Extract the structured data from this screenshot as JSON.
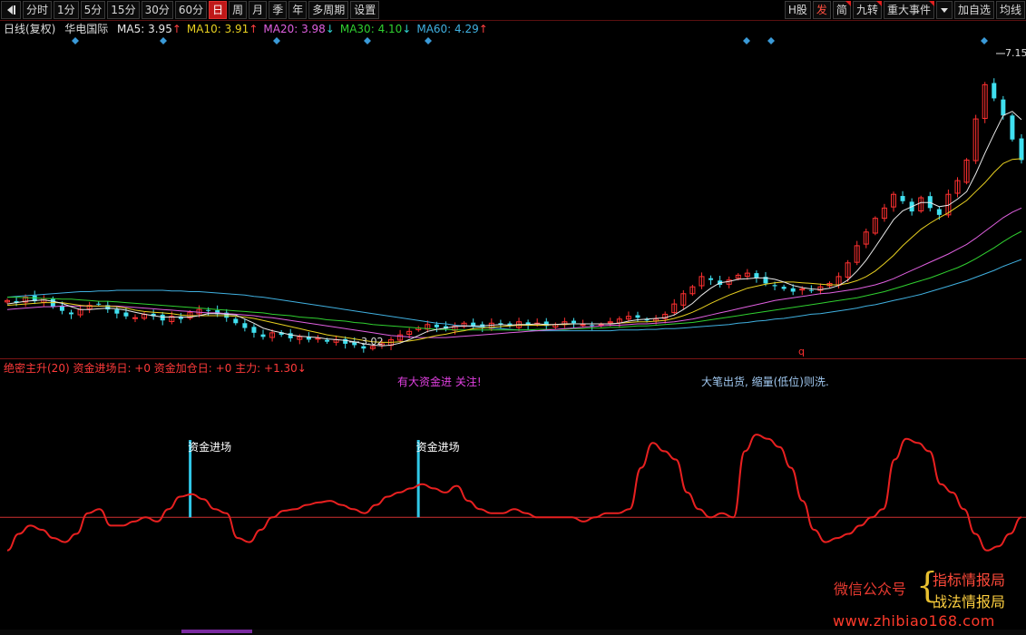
{
  "toolbar": {
    "periods": [
      "分时",
      "1分",
      "5分",
      "15分",
      "30分",
      "60分",
      "日",
      "周",
      "月",
      "季",
      "年",
      "多周期",
      "设置"
    ],
    "active_period": "日",
    "right_buttons": [
      "H股",
      "发",
      "简",
      "九转",
      "重大事件",
      "加自选",
      "均线"
    ]
  },
  "legend": {
    "period": "日线(复权)",
    "stock_name": "华电国际",
    "ma": [
      {
        "label": "MA5:",
        "value": "3.95",
        "arrow": "↑",
        "color": "#e8e8e8"
      },
      {
        "label": "MA10:",
        "value": "3.91",
        "arrow": "↑",
        "color": "#e8d020"
      },
      {
        "label": "MA20:",
        "value": "3.98",
        "arrow": "↓",
        "color": "#e060e0"
      },
      {
        "label": "MA30:",
        "value": "4.10",
        "arrow": "↓",
        "color": "#30d030"
      },
      {
        "label": "MA60:",
        "value": "4.29",
        "arrow": "↑",
        "color": "#40b0e0"
      }
    ]
  },
  "price_panel": {
    "high_label": "7.15",
    "low_label": "3.02",
    "marker_q": "q"
  },
  "indicator": {
    "legend": "绝密主升(20) 资金进场日: +0 资金加仓日: +0 主力: +1.30↓",
    "note_1": "有大资金进  关注!",
    "note_2": "大笔出货, 缩量(低位)则洗.",
    "signal_label": "资金进场"
  },
  "watermark": {
    "wechat": "微信公众号",
    "brace": "{",
    "line1": "指标情报局",
    "line2": "战法情报局",
    "url": "www.zhibiao168.com"
  },
  "chart_data": {
    "type": "candlestick",
    "ylim": [
      3.0,
      7.5
    ],
    "close": [
      3.75,
      3.72,
      3.8,
      3.74,
      3.78,
      3.66,
      3.6,
      3.55,
      3.62,
      3.68,
      3.7,
      3.62,
      3.56,
      3.52,
      3.5,
      3.55,
      3.52,
      3.46,
      3.52,
      3.48,
      3.58,
      3.62,
      3.6,
      3.55,
      3.5,
      3.42,
      3.35,
      3.28,
      3.22,
      3.28,
      3.25,
      3.2,
      3.22,
      3.18,
      3.2,
      3.15,
      3.18,
      3.12,
      3.1,
      3.05,
      3.08,
      3.12,
      3.18,
      3.25,
      3.3,
      3.35,
      3.4,
      3.36,
      3.34,
      3.38,
      3.42,
      3.38,
      3.36,
      3.42,
      3.4,
      3.38,
      3.44,
      3.4,
      3.42,
      3.38,
      3.4,
      3.44,
      3.42,
      3.4,
      3.38,
      3.4,
      3.44,
      3.48,
      3.52,
      3.5,
      3.46,
      3.48,
      3.55,
      3.7,
      3.85,
      3.95,
      4.1,
      4.05,
      3.98,
      4.05,
      4.12,
      4.15,
      4.08,
      4.0,
      3.96,
      3.92,
      3.88,
      3.92,
      3.9,
      3.95,
      4.0,
      4.1,
      4.3,
      4.55,
      4.75,
      4.95,
      5.1,
      5.3,
      5.2,
      5.05,
      5.25,
      5.1,
      5.0,
      5.3,
      5.5,
      5.8,
      6.4,
      6.9,
      6.7,
      6.45,
      6.1,
      5.8
    ],
    "ma5": [
      3.7,
      3.72,
      3.74,
      3.75,
      3.76,
      3.74,
      3.71,
      3.66,
      3.62,
      3.62,
      3.63,
      3.64,
      3.63,
      3.61,
      3.58,
      3.55,
      3.53,
      3.51,
      3.51,
      3.51,
      3.51,
      3.53,
      3.56,
      3.56,
      3.55,
      3.54,
      3.48,
      3.42,
      3.35,
      3.31,
      3.28,
      3.25,
      3.23,
      3.22,
      3.21,
      3.19,
      3.18,
      3.17,
      3.15,
      3.12,
      3.1,
      3.09,
      3.1,
      3.13,
      3.18,
      3.24,
      3.3,
      3.33,
      3.35,
      3.37,
      3.38,
      3.38,
      3.38,
      3.39,
      3.4,
      3.39,
      3.4,
      3.4,
      3.41,
      3.4,
      3.4,
      3.41,
      3.41,
      3.41,
      3.41,
      3.41,
      3.41,
      3.42,
      3.45,
      3.47,
      3.48,
      3.49,
      3.5,
      3.54,
      3.62,
      3.71,
      3.83,
      3.93,
      4.01,
      4.03,
      4.06,
      4.07,
      4.08,
      4.08,
      4.06,
      4.02,
      3.97,
      3.94,
      3.92,
      3.91,
      3.93,
      3.97,
      4.05,
      4.18,
      4.34,
      4.53,
      4.73,
      4.93,
      5.06,
      5.12,
      5.18,
      5.18,
      5.12,
      5.14,
      5.23,
      5.34,
      5.6,
      5.9,
      6.18,
      6.45,
      6.51,
      6.39
    ],
    "ma10": [
      3.68,
      3.69,
      3.7,
      3.71,
      3.72,
      3.72,
      3.72,
      3.7,
      3.68,
      3.67,
      3.67,
      3.67,
      3.66,
      3.64,
      3.61,
      3.59,
      3.58,
      3.57,
      3.56,
      3.54,
      3.53,
      3.53,
      3.53,
      3.53,
      3.53,
      3.52,
      3.51,
      3.49,
      3.46,
      3.43,
      3.4,
      3.37,
      3.34,
      3.31,
      3.28,
      3.25,
      3.23,
      3.21,
      3.19,
      3.17,
      3.15,
      3.14,
      3.14,
      3.15,
      3.16,
      3.18,
      3.21,
      3.24,
      3.26,
      3.29,
      3.31,
      3.34,
      3.35,
      3.36,
      3.37,
      3.38,
      3.39,
      3.39,
      3.39,
      3.39,
      3.4,
      3.4,
      3.41,
      3.41,
      3.41,
      3.41,
      3.41,
      3.42,
      3.43,
      3.44,
      3.44,
      3.45,
      3.46,
      3.49,
      3.53,
      3.58,
      3.64,
      3.71,
      3.77,
      3.83,
      3.88,
      3.93,
      3.96,
      3.99,
      4.01,
      4.02,
      4.02,
      4.01,
      4.0,
      3.99,
      3.98,
      3.98,
      4.0,
      4.04,
      4.1,
      4.18,
      4.29,
      4.41,
      4.55,
      4.67,
      4.79,
      4.88,
      4.96,
      5.03,
      5.12,
      5.21,
      5.34,
      5.47,
      5.62,
      5.75,
      5.81,
      5.82
    ],
    "ma20": [
      3.62,
      3.63,
      3.64,
      3.65,
      3.66,
      3.66,
      3.67,
      3.67,
      3.67,
      3.67,
      3.67,
      3.67,
      3.67,
      3.66,
      3.65,
      3.64,
      3.63,
      3.62,
      3.61,
      3.6,
      3.59,
      3.58,
      3.57,
      3.57,
      3.56,
      3.55,
      3.54,
      3.53,
      3.51,
      3.5,
      3.48,
      3.46,
      3.44,
      3.42,
      3.4,
      3.38,
      3.36,
      3.34,
      3.32,
      3.3,
      3.28,
      3.26,
      3.24,
      3.23,
      3.22,
      3.21,
      3.21,
      3.21,
      3.21,
      3.22,
      3.23,
      3.24,
      3.25,
      3.26,
      3.27,
      3.28,
      3.29,
      3.3,
      3.31,
      3.32,
      3.33,
      3.34,
      3.35,
      3.36,
      3.37,
      3.38,
      3.39,
      3.39,
      3.4,
      3.41,
      3.41,
      3.42,
      3.43,
      3.44,
      3.46,
      3.48,
      3.51,
      3.54,
      3.57,
      3.6,
      3.63,
      3.66,
      3.69,
      3.72,
      3.75,
      3.77,
      3.79,
      3.81,
      3.83,
      3.85,
      3.86,
      3.88,
      3.9,
      3.92,
      3.95,
      3.98,
      4.02,
      4.07,
      4.13,
      4.19,
      4.25,
      4.31,
      4.37,
      4.43,
      4.5,
      4.57,
      4.66,
      4.76,
      4.86,
      4.96,
      5.04,
      5.1
    ],
    "ma30": [
      3.8,
      3.8,
      3.79,
      3.79,
      3.78,
      3.78,
      3.77,
      3.77,
      3.76,
      3.75,
      3.74,
      3.74,
      3.73,
      3.72,
      3.71,
      3.7,
      3.69,
      3.68,
      3.67,
      3.66,
      3.65,
      3.64,
      3.63,
      3.62,
      3.61,
      3.6,
      3.59,
      3.58,
      3.57,
      3.55,
      3.54,
      3.53,
      3.51,
      3.5,
      3.49,
      3.47,
      3.46,
      3.45,
      3.43,
      3.42,
      3.4,
      3.39,
      3.38,
      3.37,
      3.36,
      3.35,
      3.34,
      3.33,
      3.33,
      3.32,
      3.32,
      3.32,
      3.32,
      3.32,
      3.32,
      3.32,
      3.32,
      3.32,
      3.33,
      3.33,
      3.33,
      3.33,
      3.34,
      3.34,
      3.35,
      3.35,
      3.36,
      3.36,
      3.37,
      3.38,
      3.38,
      3.39,
      3.4,
      3.41,
      3.42,
      3.43,
      3.45,
      3.47,
      3.49,
      3.51,
      3.53,
      3.55,
      3.57,
      3.59,
      3.61,
      3.63,
      3.65,
      3.67,
      3.69,
      3.71,
      3.73,
      3.75,
      3.77,
      3.79,
      3.82,
      3.85,
      3.88,
      3.92,
      3.96,
      4.0,
      4.04,
      4.08,
      4.13,
      4.18,
      4.23,
      4.29,
      4.36,
      4.44,
      4.52,
      4.61,
      4.69,
      4.76
    ],
    "ma60": [
      3.8,
      3.81,
      3.82,
      3.83,
      3.84,
      3.85,
      3.86,
      3.87,
      3.88,
      3.88,
      3.89,
      3.89,
      3.9,
      3.9,
      3.9,
      3.9,
      3.9,
      3.9,
      3.89,
      3.89,
      3.88,
      3.88,
      3.87,
      3.86,
      3.85,
      3.84,
      3.83,
      3.81,
      3.8,
      3.78,
      3.76,
      3.74,
      3.72,
      3.7,
      3.68,
      3.66,
      3.64,
      3.62,
      3.6,
      3.58,
      3.56,
      3.54,
      3.52,
      3.5,
      3.48,
      3.46,
      3.44,
      3.42,
      3.41,
      3.39,
      3.38,
      3.37,
      3.36,
      3.35,
      3.34,
      3.33,
      3.32,
      3.32,
      3.31,
      3.31,
      3.31,
      3.31,
      3.31,
      3.31,
      3.31,
      3.31,
      3.31,
      3.32,
      3.32,
      3.32,
      3.33,
      3.33,
      3.34,
      3.34,
      3.35,
      3.36,
      3.37,
      3.38,
      3.39,
      3.4,
      3.42,
      3.43,
      3.45,
      3.46,
      3.48,
      3.49,
      3.51,
      3.53,
      3.55,
      3.56,
      3.58,
      3.6,
      3.62,
      3.64,
      3.67,
      3.69,
      3.72,
      3.75,
      3.78,
      3.81,
      3.84,
      3.88,
      3.92,
      3.96,
      4.0,
      4.04,
      4.09,
      4.14,
      4.19,
      4.25,
      4.3,
      4.35
    ],
    "indicator_ylim": [
      -60,
      110
    ],
    "indicator": [
      -40,
      -20,
      -10,
      -15,
      -25,
      -30,
      -20,
      5,
      10,
      -10,
      -10,
      -5,
      0,
      -5,
      10,
      25,
      28,
      22,
      10,
      5,
      -25,
      -30,
      -15,
      0,
      8,
      10,
      15,
      18,
      20,
      15,
      10,
      5,
      15,
      25,
      30,
      35,
      40,
      35,
      30,
      38,
      20,
      10,
      5,
      5,
      10,
      5,
      0,
      0,
      0,
      0,
      -5,
      0,
      5,
      5,
      10,
      60,
      90,
      80,
      70,
      30,
      10,
      0,
      5,
      0,
      80,
      100,
      95,
      85,
      60,
      20,
      -15,
      -30,
      -25,
      -20,
      -10,
      0,
      10,
      70,
      95,
      90,
      80,
      40,
      30,
      10,
      -20,
      -40,
      -35,
      -20,
      0
    ],
    "signal_bars": [
      {
        "x": 0.162,
        "h": 0.55
      },
      {
        "x": 0.387,
        "h": 0.55
      }
    ]
  }
}
